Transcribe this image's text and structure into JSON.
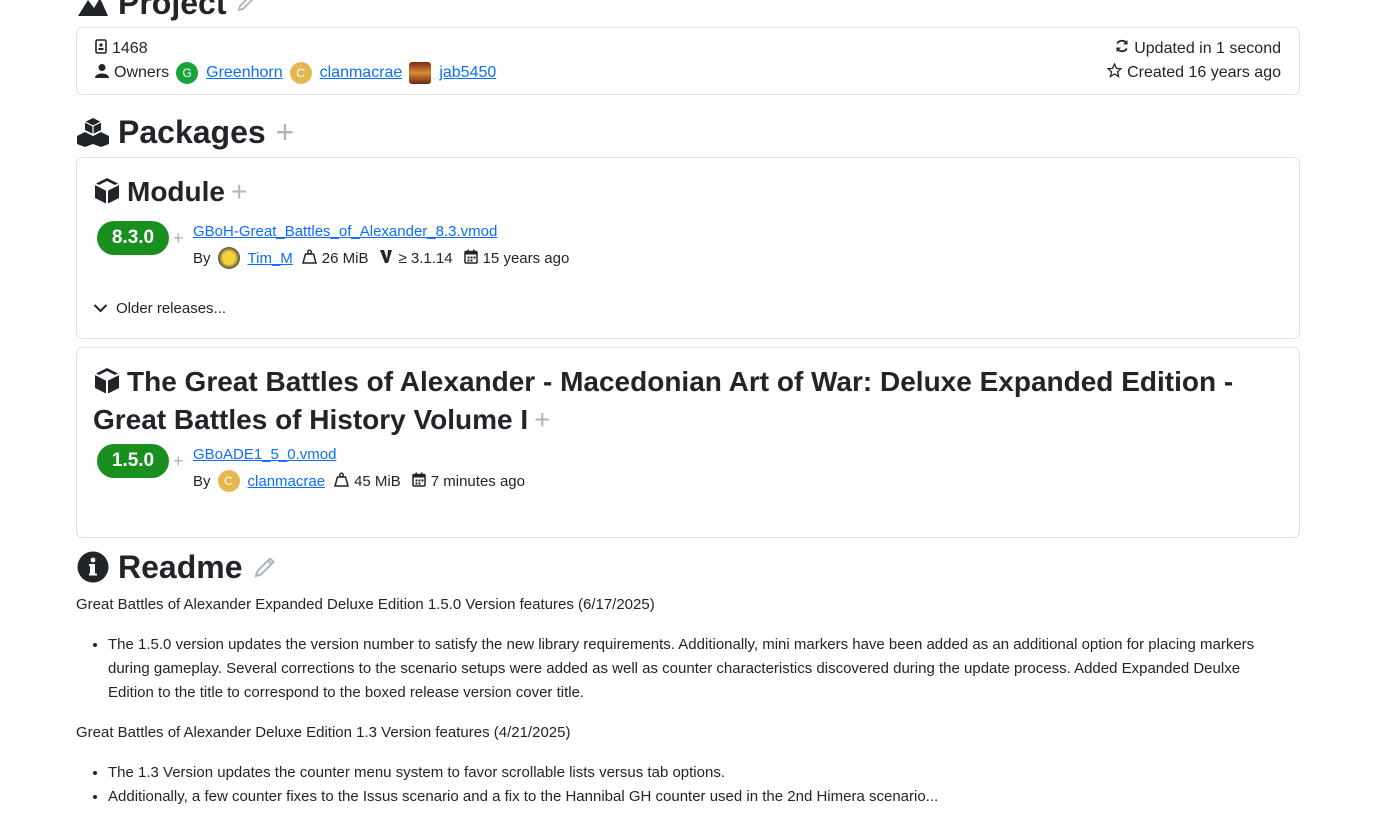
{
  "project": {
    "title": "Project",
    "id": "1468",
    "owners_label": "Owners",
    "owners": [
      {
        "initial": "G",
        "name": "Greenhorn",
        "color": "#1aa33a"
      },
      {
        "initial": "C",
        "name": "clanmacrae",
        "color": "#e5b84f"
      },
      {
        "initial": "",
        "name": "jab5450",
        "color": "#b5562a"
      }
    ],
    "updated": "Updated in 1 second",
    "created": "Created 16 years ago"
  },
  "packages": {
    "title": "Packages",
    "items": [
      {
        "name": "Module",
        "version": "8.3.0",
        "file": "GBoH-Great_Battles_of_Alexander_8.3.vmod",
        "by_label": "By",
        "author": "Tim_M",
        "size": "26 MiB",
        "requires": "≥ 3.1.14",
        "date": "15 years ago",
        "older": "Older releases..."
      },
      {
        "name": "The Great Battles of Alexander - Macedonian Art of War: Deluxe Expanded Edition - Great Battles of History Volume I",
        "version": "1.5.0",
        "file": "GBoADE1_5_0.vmod",
        "by_label": "By",
        "author_initial": "C",
        "author": "clanmacrae",
        "size": "45 MiB",
        "date": "7 minutes ago"
      }
    ]
  },
  "readme": {
    "title": "Readme",
    "sections": [
      {
        "heading": "Great Battles of Alexander Expanded Deluxe Edition 1.5.0 Version features (6/17/2025)",
        "bullets": [
          "The 1.5.0 version updates the version number to satisfy the new library requirements. Additionally, mini markers have been added as an additional option for placing markers during gameplay. Several corrections to the scenario setups were added as well as counter characteristics discovered during the update process. Added Expanded Deulxe Edition to the title to correspond to the boxed release version cover title."
        ]
      },
      {
        "heading": "Great Battles of Alexander Deluxe Edition 1.3 Version features (4/21/2025)",
        "bullets": [
          "The 1.3 Version updates the counter menu system to favor scrollable lists versus tab options.",
          "Additionally, a few counter fixes to the Issus scenario and a fix to the Hannibal GH counter used in the 2nd Himera scenario..."
        ]
      }
    ]
  },
  "colors": {
    "badge": "#198f1f",
    "link": "#0d6efd",
    "muted": "#adb5bd"
  }
}
